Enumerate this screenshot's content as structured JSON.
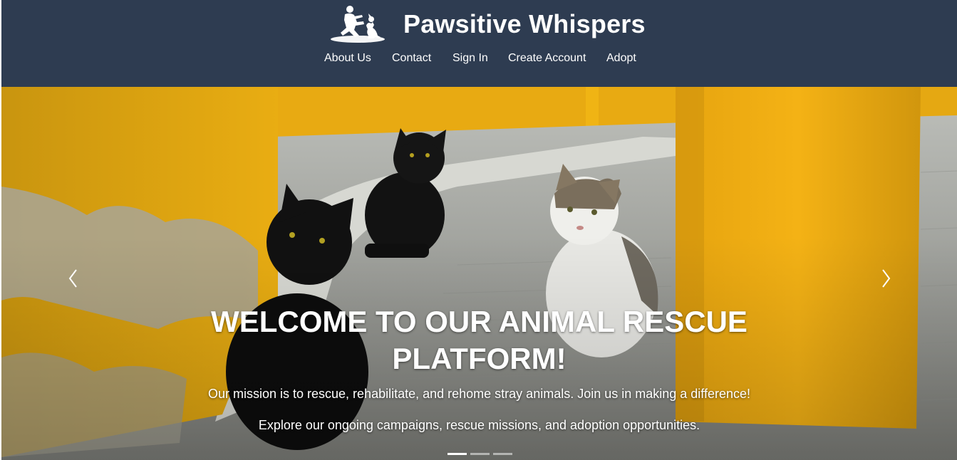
{
  "header": {
    "brand_name": "Pawsitive Whispers",
    "logo_icon": "person-with-dog-logo",
    "background_color": "#2e3c51"
  },
  "nav": {
    "items": [
      {
        "label": "About Us"
      },
      {
        "label": "Contact"
      },
      {
        "label": "Sign In"
      },
      {
        "label": "Create Account"
      },
      {
        "label": "Adopt"
      }
    ]
  },
  "carousel": {
    "image_icon": "cats-on-street-photo",
    "prev_icon": "chevron-left-icon",
    "next_icon": "chevron-right-icon",
    "title": "WELCOME TO OUR ANIMAL RESCUE PLATFORM!",
    "line1": "Our mission is to rescue, rehabilitate, and rehome stray animals. Join us in making a difference!",
    "line2": "Explore our ongoing campaigns, rescue missions, and adoption opportunities.",
    "slide_count": 3,
    "active_slide": 1
  }
}
